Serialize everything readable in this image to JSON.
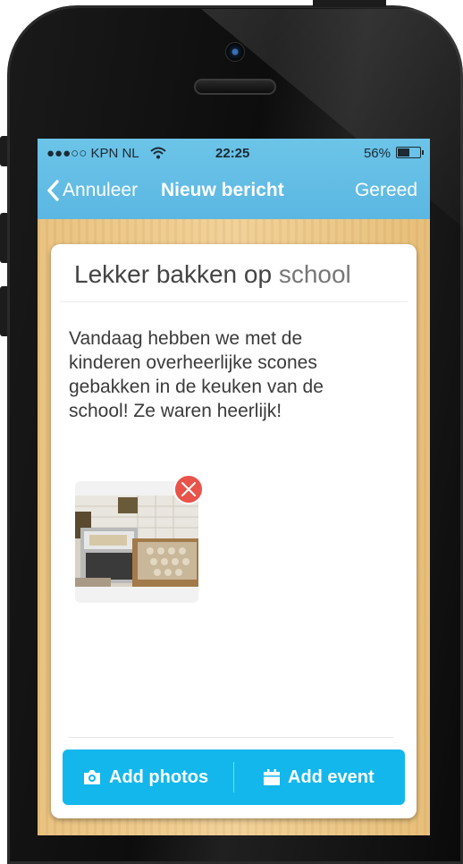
{
  "status": {
    "carrier": "●●●○○ KPN NL",
    "time": "22:25",
    "battery": "56%",
    "battery_level": 0.56
  },
  "nav": {
    "back_label": "Annuleer",
    "title": "Nieuw bericht",
    "done_label": "Gereed"
  },
  "post": {
    "title_main": "Lekker bakken op ",
    "title_muted": "school",
    "body": "Vandaag hebben we met de kinderen overheerlijke scones gebakken in de keuken van de school! Ze waren heerlijk!"
  },
  "attachment": {
    "icon": "remove-icon"
  },
  "actions": {
    "add_photos": "Add photos",
    "add_event": "Add event"
  },
  "colors": {
    "nav_bg": "#5bb7e2",
    "action_bg": "#13b7ec",
    "remove": "#e8534a"
  }
}
